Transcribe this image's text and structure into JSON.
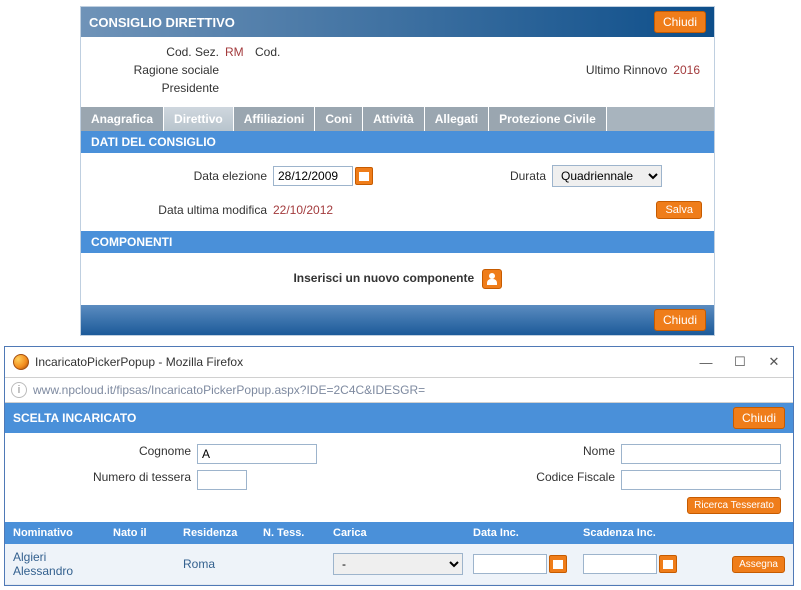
{
  "header": {
    "title": "CONSIGLIO DIRETTIVO",
    "close_label": "Chiudi"
  },
  "info": {
    "cod_sez_label": "Cod. Sez.",
    "cod_sez_value": "RM",
    "cod_label": "Cod.",
    "ragione_label": "Ragione sociale",
    "ultimo_rinnovo_label": "Ultimo Rinnovo",
    "ultimo_rinnovo_value": "2016",
    "presidente_label": "Presidente"
  },
  "tabs": [
    "Anagrafica",
    "Direttivo",
    "Affiliazioni",
    "Coni",
    "Attività",
    "Allegati",
    "Protezione Civile"
  ],
  "dati_consiglio": {
    "title": "DATI DEL CONSIGLIO",
    "data_elezione_label": "Data elezione",
    "data_elezione_value": "28/12/2009",
    "durata_label": "Durata",
    "durata_value": "Quadriennale",
    "data_ultima_mod_label": "Data ultima modifica",
    "data_ultima_mod_value": "22/10/2012",
    "salva_label": "Salva"
  },
  "componenti": {
    "title": "COMPONENTI",
    "insert_label": "Inserisci un nuovo componente"
  },
  "footer": {
    "close_label": "Chiudi"
  },
  "popup": {
    "win_title": "IncaricatoPickerPopup - Mozilla Firefox",
    "url": "www.npcloud.it/fipsas/IncaricatoPickerPopup.aspx?IDE=2C4C&IDESGR=",
    "section_title": "SCELTA INCARICATO",
    "close_label": "Chiudi",
    "search": {
      "cognome_label": "Cognome",
      "cognome_value": "A",
      "nome_label": "Nome",
      "nome_value": "",
      "tessera_label": "Numero di tessera",
      "tessera_value": "",
      "cf_label": "Codice Fiscale",
      "cf_value": "",
      "ricerca_label": "Ricerca Tesserato"
    },
    "columns": [
      "Nominativo",
      "Nato il",
      "Residenza",
      "N. Tess.",
      "Carica",
      "Data Inc.",
      "Scadenza Inc."
    ],
    "rows": [
      {
        "nominativo": "Algieri Alessandro",
        "nato": "",
        "residenza": "Roma",
        "tess": "",
        "carica": "-",
        "data_inc": "",
        "scad_inc": "",
        "assegna": "Assegna"
      }
    ]
  }
}
